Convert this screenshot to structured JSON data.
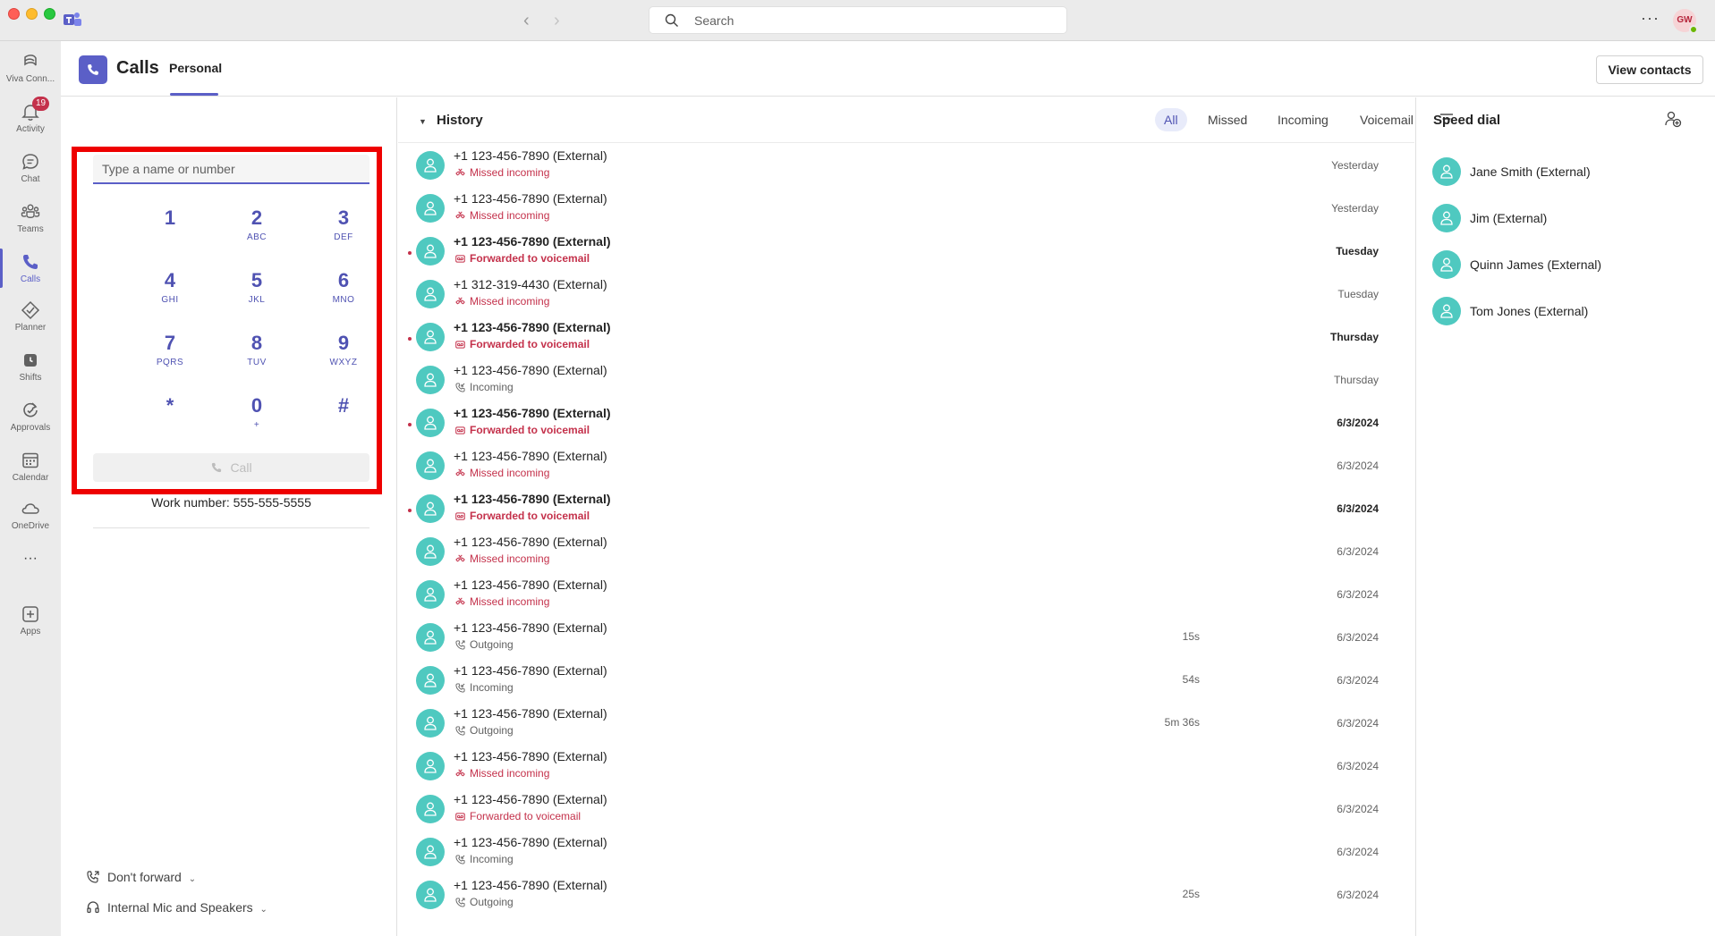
{
  "titlebar": {
    "search_placeholder": "Search",
    "more_label": "···",
    "user_initials": "GW"
  },
  "rail": {
    "items": [
      {
        "label": "Viva Conn...",
        "icon": "viva-connections-icon"
      },
      {
        "label": "Activity",
        "icon": "bell-icon",
        "badge": "19"
      },
      {
        "label": "Chat",
        "icon": "chat-icon"
      },
      {
        "label": "Teams",
        "icon": "teams-icon"
      },
      {
        "label": "Calls",
        "icon": "phone-icon"
      },
      {
        "label": "Planner",
        "icon": "planner-icon"
      },
      {
        "label": "Shifts",
        "icon": "shifts-icon"
      },
      {
        "label": "Approvals",
        "icon": "approvals-icon"
      },
      {
        "label": "Calendar",
        "icon": "calendar-icon"
      },
      {
        "label": "OneDrive",
        "icon": "cloud-icon"
      },
      {
        "label": "···",
        "icon": "more-apps-icon"
      },
      {
        "label": "Apps",
        "icon": "add-apps-icon"
      }
    ]
  },
  "header": {
    "title": "Calls",
    "tab": "Personal",
    "view_contacts": "View contacts"
  },
  "dialer": {
    "placeholder": "Type a name or number",
    "keys": [
      {
        "digit": "1",
        "letters": ""
      },
      {
        "digit": "2",
        "letters": "ABC"
      },
      {
        "digit": "3",
        "letters": "DEF"
      },
      {
        "digit": "4",
        "letters": "GHI"
      },
      {
        "digit": "5",
        "letters": "JKL"
      },
      {
        "digit": "6",
        "letters": "MNO"
      },
      {
        "digit": "7",
        "letters": "PQRS"
      },
      {
        "digit": "8",
        "letters": "TUV"
      },
      {
        "digit": "9",
        "letters": "WXYZ"
      },
      {
        "digit": "*",
        "letters": ""
      },
      {
        "digit": "0",
        "letters": "+"
      },
      {
        "digit": "#",
        "letters": ""
      }
    ],
    "call_label": "Call",
    "work_number": "Work number:  555-555-5555",
    "forward_label": "Don't forward",
    "audio_label": "Internal Mic and Speakers"
  },
  "history": {
    "title": "History",
    "filters": [
      "All",
      "Missed",
      "Incoming",
      "Voicemail"
    ],
    "active_filter": "All",
    "rows": [
      {
        "name": "+1 123-456-7890 (External)",
        "type": "missed",
        "status": "Missed incoming",
        "duration": "",
        "date": "Yesterday",
        "unread": false
      },
      {
        "name": "+1 123-456-7890 (External)",
        "type": "missed",
        "status": "Missed incoming",
        "duration": "",
        "date": "Yesterday",
        "unread": false
      },
      {
        "name": "+1 123-456-7890 (External)",
        "type": "voicemail",
        "status": "Forwarded to voicemail",
        "duration": "",
        "date": "Tuesday",
        "unread": true
      },
      {
        "name": "+1 312-319-4430 (External)",
        "type": "missed",
        "status": "Missed incoming",
        "duration": "",
        "date": "Tuesday",
        "unread": false
      },
      {
        "name": "+1 123-456-7890 (External)",
        "type": "voicemail",
        "status": "Forwarded to voicemail",
        "duration": "",
        "date": "Thursday",
        "unread": true
      },
      {
        "name": "+1 123-456-7890 (External)",
        "type": "incoming",
        "status": "Incoming",
        "duration": "",
        "date": "Thursday",
        "unread": false
      },
      {
        "name": "+1 123-456-7890 (External)",
        "type": "voicemail",
        "status": "Forwarded to voicemail",
        "duration": "",
        "date": "6/3/2024",
        "unread": true
      },
      {
        "name": "+1 123-456-7890 (External)",
        "type": "missed",
        "status": "Missed incoming",
        "duration": "",
        "date": "6/3/2024",
        "unread": false
      },
      {
        "name": "+1 123-456-7890 (External)",
        "type": "voicemail",
        "status": "Forwarded to voicemail",
        "duration": "",
        "date": "6/3/2024",
        "unread": true
      },
      {
        "name": "+1 123-456-7890 (External)",
        "type": "missed",
        "status": "Missed incoming",
        "duration": "",
        "date": "6/3/2024",
        "unread": false
      },
      {
        "name": "+1 123-456-7890 (External)",
        "type": "missed",
        "status": "Missed incoming",
        "duration": "",
        "date": "6/3/2024",
        "unread": false
      },
      {
        "name": "+1 123-456-7890 (External)",
        "type": "outgoing",
        "status": "Outgoing",
        "duration": "15s",
        "date": "6/3/2024",
        "unread": false
      },
      {
        "name": "+1 123-456-7890 (External)",
        "type": "incoming",
        "status": "Incoming",
        "duration": "54s",
        "date": "6/3/2024",
        "unread": false
      },
      {
        "name": "+1 123-456-7890 (External)",
        "type": "outgoing",
        "status": "Outgoing",
        "duration": "5m 36s",
        "date": "6/3/2024",
        "unread": false
      },
      {
        "name": "+1 123-456-7890 (External)",
        "type": "missed",
        "status": "Missed incoming",
        "duration": "",
        "date": "6/3/2024",
        "unread": false
      },
      {
        "name": "+1 123-456-7890 (External)",
        "type": "voicemail",
        "status": "Forwarded to voicemail",
        "duration": "",
        "date": "6/3/2024",
        "unread": false
      },
      {
        "name": "+1 123-456-7890 (External)",
        "type": "incoming",
        "status": "Incoming",
        "duration": "",
        "date": "6/3/2024",
        "unread": false
      },
      {
        "name": "+1 123-456-7890 (External)",
        "type": "outgoing",
        "status": "Outgoing",
        "duration": "25s",
        "date": "6/3/2024",
        "unread": false
      }
    ]
  },
  "speed_dial": {
    "title": "Speed dial",
    "contacts": [
      "Jane Smith (External)",
      "Jim (External)",
      "Quinn James (External)",
      "Tom Jones (External)"
    ]
  },
  "colors": {
    "brand": "#5b5fc7",
    "missed": "#c4314b",
    "avatar": "#4fc9c0",
    "highlight_frame": "#ee0000"
  }
}
